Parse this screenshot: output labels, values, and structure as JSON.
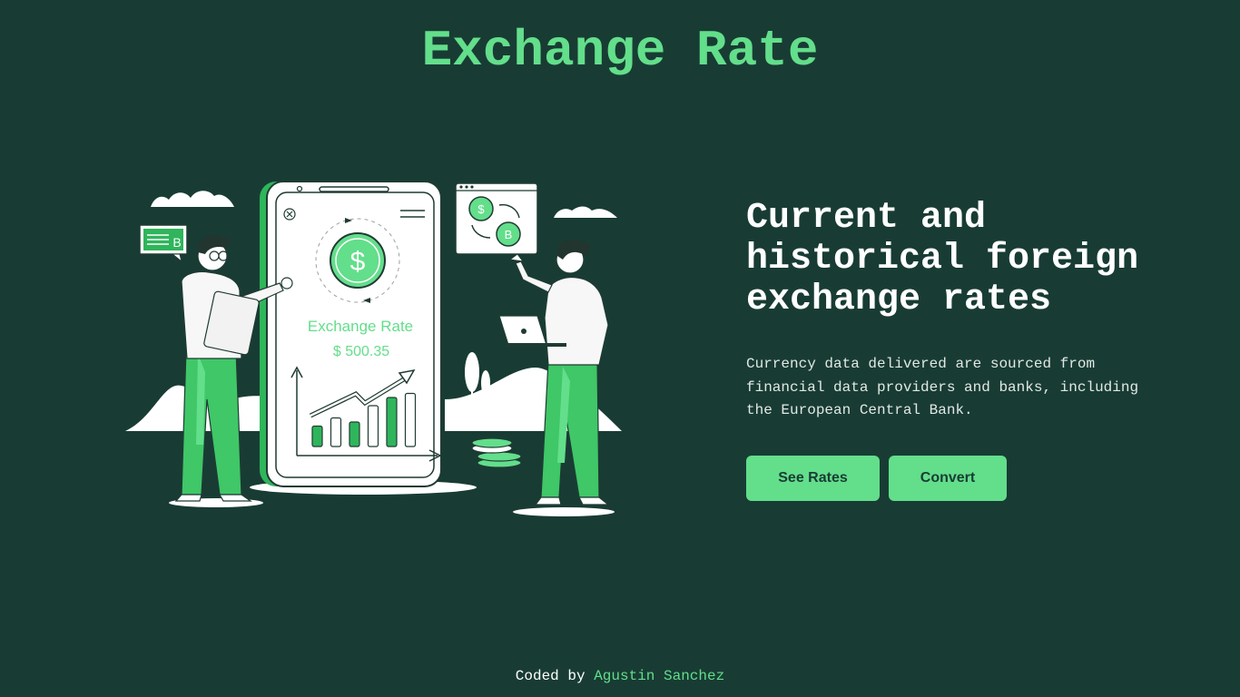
{
  "header": {
    "title": "Exchange Rate"
  },
  "illustration": {
    "phone_title": "Exchange Rate",
    "phone_value": "$ 500.35",
    "currency_symbol": "$",
    "crypto_symbol": "B",
    "bars": [
      0.25,
      0.35,
      0.3,
      0.5,
      0.6,
      0.65
    ]
  },
  "hero": {
    "headline": "Current and historical foreign exchange rates",
    "description": "Currency data delivered are sourced from financial data providers and banks, including the European Central Bank.",
    "buttons": {
      "see_rates": "See Rates",
      "convert": "Convert"
    }
  },
  "footer": {
    "prefix": "Coded by ",
    "author": "Agustin Sanchez"
  },
  "colors": {
    "background": "#183c34",
    "accent": "#63de8b",
    "accent_dark": "#2fb55b"
  }
}
